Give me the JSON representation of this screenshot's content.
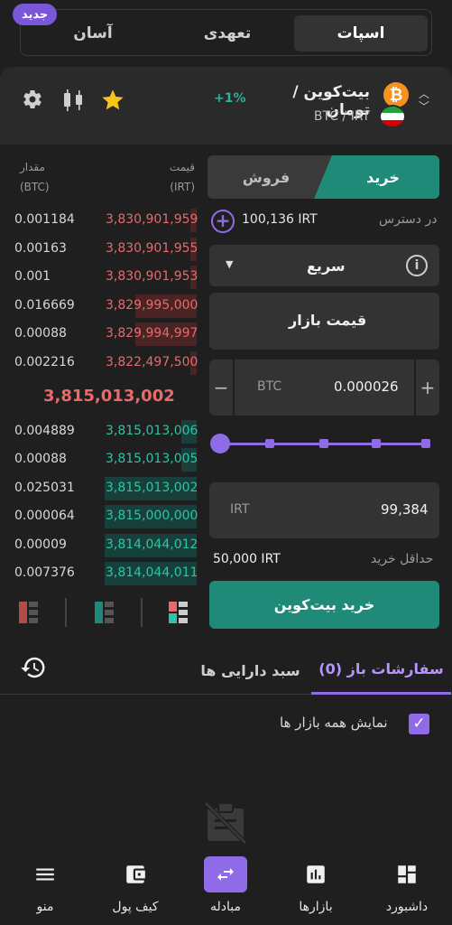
{
  "mode_tabs": {
    "spot": "اسپات",
    "margin": "تعهدی",
    "easy": "آسان",
    "new_badge": "جدید"
  },
  "market": {
    "pair_name": "بیت‌کوین / تومان",
    "symbol": "BTC / IRT",
    "change": "+1%",
    "coin_glyph": "₿"
  },
  "orderbook": {
    "price_header": [
      "قیمت",
      "(IRT)"
    ],
    "amount_header": [
      "مقدار",
      "(BTC)"
    ],
    "asks": [
      {
        "price": "3,830,901,959",
        "amount": "0.001184",
        "depth": 0.03
      },
      {
        "price": "3,830,901,955",
        "amount": "0.00163",
        "depth": 0.03
      },
      {
        "price": "3,830,901,953",
        "amount": "0.001",
        "depth": 0.03
      },
      {
        "price": "3,829,995,000",
        "amount": "0.016669",
        "depth": 0.31
      },
      {
        "price": "3,829,994,997",
        "amount": "0.00088",
        "depth": 0.31
      },
      {
        "price": "3,822,497,500",
        "amount": "0.002216",
        "depth": 0.03
      }
    ],
    "last_price": "3,815,013,002",
    "bids": [
      {
        "price": "3,815,013,006",
        "amount": "0.004889",
        "depth": 0.08
      },
      {
        "price": "3,815,013,005",
        "amount": "0.00088",
        "depth": 0.08
      },
      {
        "price": "3,815,013,002",
        "amount": "0.025031",
        "depth": 0.47
      },
      {
        "price": "3,815,000,000",
        "amount": "0.000064",
        "depth": 0.47
      },
      {
        "price": "3,814,044,012",
        "amount": "0.00009",
        "depth": 0.47
      },
      {
        "price": "3,814,044,011",
        "amount": "0.007376",
        "depth": 0.47
      }
    ]
  },
  "order_form": {
    "buy_tab": "خرید",
    "sell_tab": "فروش",
    "available_label": "در دسترس",
    "available_value": "100,136 IRT",
    "order_type": "سریع",
    "market_price_label": "قیمت بازار",
    "amount_unit": "BTC",
    "amount_value": "0.000026",
    "slider_level": 0,
    "total_unit": "IRT",
    "total_value": "99,384",
    "min_buy_label": "حداقل خرید",
    "min_buy_value": "50,000 IRT",
    "submit_label": "خرید بیت‌کوین"
  },
  "orders": {
    "open_orders_tab": "سفارشات باز (0)",
    "portfolio_tab": "سبد دارایی ها",
    "show_all_markets": "نمایش همه بازار ها"
  },
  "nav": [
    {
      "label": "داشبورد",
      "icon": "dashboard-icon"
    },
    {
      "label": "بازارها",
      "icon": "markets-icon"
    },
    {
      "label": "مبادله",
      "icon": "exchange-icon"
    },
    {
      "label": "کیف پول",
      "icon": "wallet-icon"
    },
    {
      "label": "منو",
      "icon": "menu-icon"
    }
  ],
  "colors": {
    "accent": "#8f6be8",
    "buy": "#1f8a78",
    "ask": "#e86a6a",
    "bid": "#2fc4a6"
  }
}
